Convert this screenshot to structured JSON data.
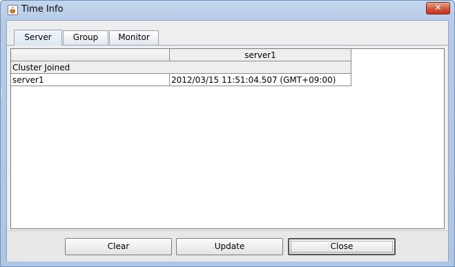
{
  "window": {
    "title": "Time Info",
    "close_glyph": "✕"
  },
  "tabs": [
    {
      "label": "Server",
      "active": true
    },
    {
      "label": "Group",
      "active": false
    },
    {
      "label": "Monitor",
      "active": false
    }
  ],
  "table": {
    "columns": [
      "",
      "server1"
    ],
    "section": "Cluster Joined",
    "rows": [
      {
        "name": "server1",
        "time": "2012/03/15 11:51:04.507 (GMT+09:00)"
      }
    ]
  },
  "buttons": {
    "clear": "Clear",
    "update": "Update",
    "close": "Close"
  },
  "colors": {
    "title_bar": "#b6cbe8",
    "close_button": "#c2341a"
  },
  "icons": {
    "app": "java-cup-icon",
    "close": "close-icon"
  }
}
